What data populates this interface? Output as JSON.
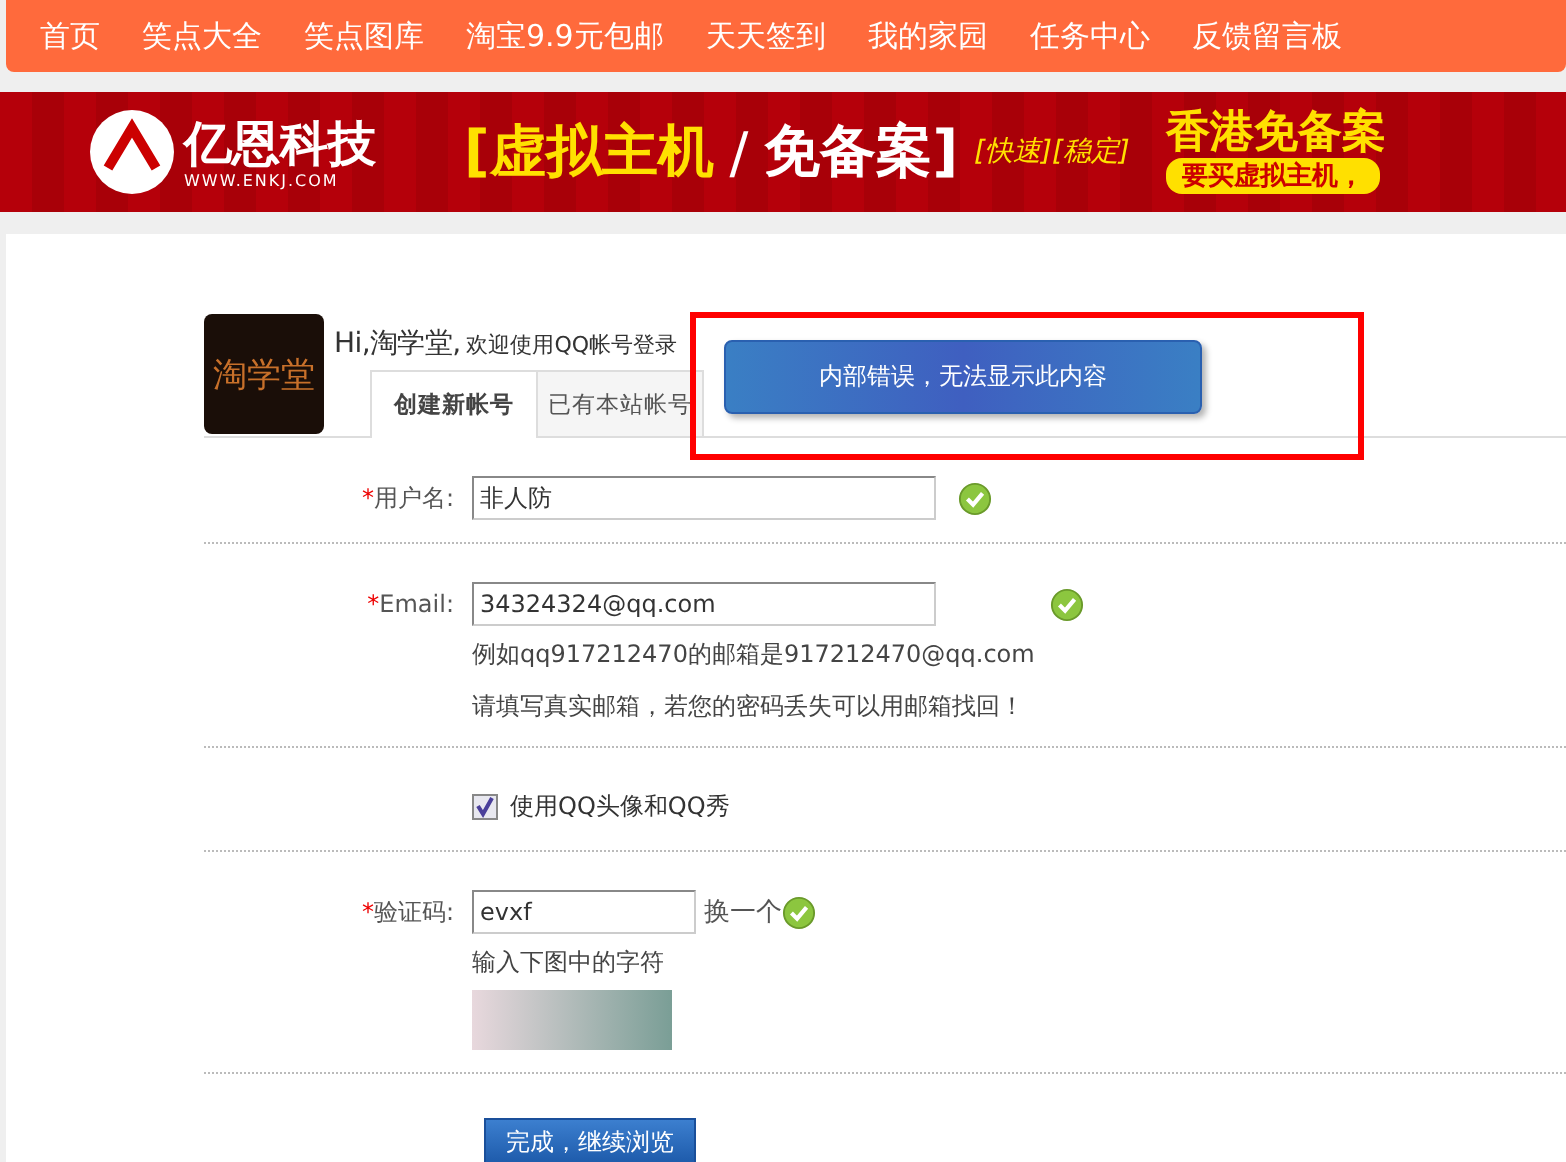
{
  "nav": [
    {
      "label": "首页"
    },
    {
      "label": "笑点大全"
    },
    {
      "label": "笑点图库"
    },
    {
      "label": "淘宝9.9元包邮"
    },
    {
      "label": "天天签到"
    },
    {
      "label": "我的家园"
    },
    {
      "label": "任务中心"
    },
    {
      "label": "反馈留言板"
    }
  ],
  "banner": {
    "logo": "亿恩科技",
    "url": "WWW.ENKJ.COM",
    "headline_1": "[虚拟主机",
    "slash": "/",
    "headline_2": "免备案]",
    "tags": "[快速][稳定]",
    "promo": "香港免备案",
    "promo_sub": "要买虚拟主机，"
  },
  "header": {
    "logo_text": "淘学堂",
    "greeting": "Hi,淘学堂,",
    "welcome": "欢迎使用QQ帐号登录"
  },
  "tabs": [
    {
      "label": "创建新帐号",
      "selected": true
    },
    {
      "label": "已有本站帐号",
      "selected": false
    }
  ],
  "error_popup": {
    "message": "内部错误，无法显示此内容"
  },
  "form": {
    "username": {
      "label": "用户名:",
      "required": "*",
      "value": "非人防",
      "valid": true
    },
    "email": {
      "label": "Email:",
      "required": "*",
      "value": "34324324@qq.com",
      "valid": true,
      "hint": "例如qq917212470的邮箱是917212470@qq.com",
      "note": "请填写真实邮箱，若您的密码丢失可以用邮箱找回！"
    },
    "avatar_option": {
      "label": "使用QQ头像和QQ秀",
      "checked": true
    },
    "captcha": {
      "label": "验证码:",
      "required": "*",
      "value": "evxf",
      "refresh": "换一个",
      "valid": true,
      "hint": "输入下图中的字符"
    },
    "submit": "完成，继续浏览"
  }
}
